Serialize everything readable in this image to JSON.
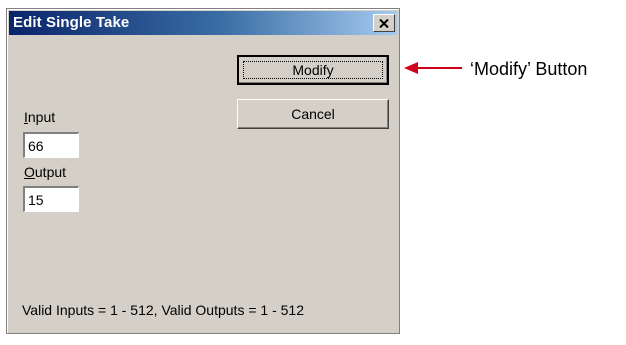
{
  "dialog": {
    "title": "Edit Single Take",
    "close_symbol": "×",
    "modify_label": "Modify",
    "cancel_label": "Cancel",
    "input": {
      "label_mnemonic": "I",
      "label_rest": "nput",
      "value": "66"
    },
    "output": {
      "label_mnemonic": "O",
      "label_rest": "utput",
      "value": "15"
    },
    "valid_text": "Valid Inputs = 1 - 512, Valid Outputs = 1 - 512"
  },
  "callout": {
    "text": "‘Modify’ Button",
    "arrow_color": "#d0021b"
  },
  "icons": {
    "close": "close-icon",
    "arrow": "arrow-left-icon"
  }
}
